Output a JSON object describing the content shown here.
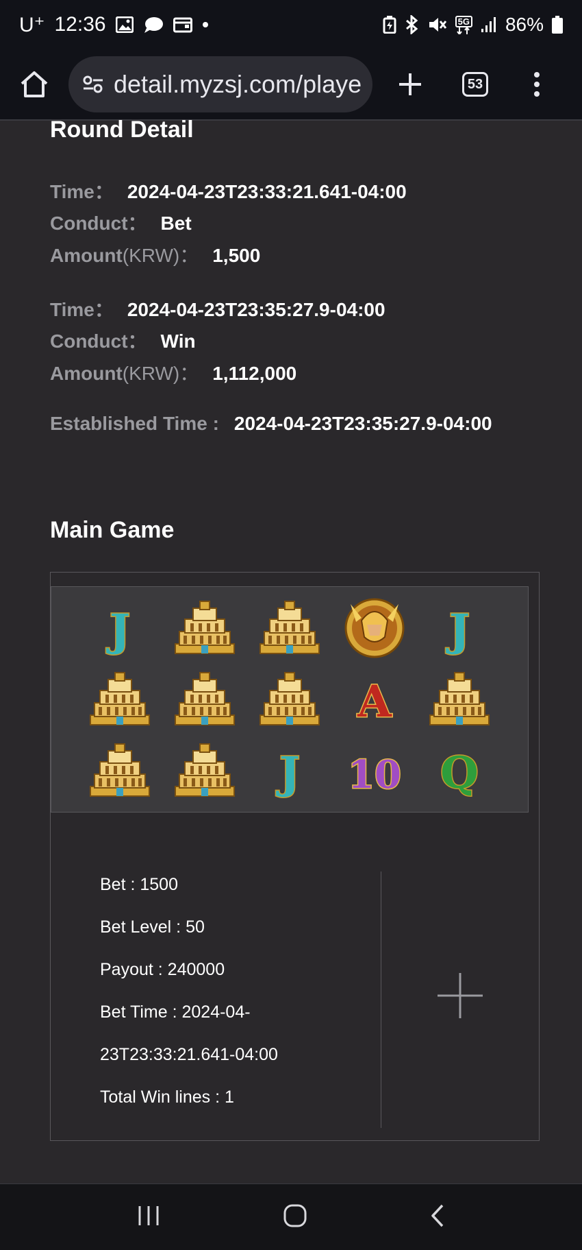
{
  "status_bar": {
    "carrier": "U⁺",
    "time": "12:36",
    "signal_label": "5G",
    "battery": "86%"
  },
  "browser": {
    "url": "detail.myzsj.com/playe",
    "tab_count": "53"
  },
  "round_detail": {
    "title": "Round Detail",
    "entries": [
      {
        "time_label": "Time：",
        "time": "2024-04-23T23:33:21.641-04:00",
        "conduct_label": "Conduct：",
        "conduct": "Bet",
        "amount_label": "Amount",
        "amount_unit": "(KRW)：",
        "amount": "1,500"
      },
      {
        "time_label": "Time：",
        "time": "2024-04-23T23:35:27.9-04:00",
        "conduct_label": "Conduct：",
        "conduct": "Win",
        "amount_label": "Amount",
        "amount_unit": "(KRW)：",
        "amount": "1,112,000"
      }
    ],
    "established_label": "Established Time :",
    "established_time": "2024-04-23T23:35:27.9-04:00"
  },
  "main_game": {
    "title": "Main Game",
    "reels": [
      [
        "J",
        "temple",
        "temple",
        "warrior",
        "J"
      ],
      [
        "temple",
        "temple",
        "temple",
        "A",
        "temple"
      ],
      [
        "temple",
        "temple",
        "J",
        "10",
        "Q"
      ]
    ],
    "info": {
      "bet": "Bet : 1500",
      "bet_level": "Bet Level : 50",
      "payout": "Payout : 240000",
      "bet_time_1": "Bet Time : 2024-04-",
      "bet_time_2": "23T23:33:21.641-04:00",
      "win_lines": "Total Win lines : 1"
    }
  },
  "colors": {
    "background": "#2a282b",
    "system_bar": "#111218",
    "label_gray": "#9a9a9f",
    "gold": "#d9a93a",
    "teal": "#34b4b8",
    "red": "#c0281f",
    "purple": "#a04dc4",
    "green": "#2e9e3c"
  }
}
